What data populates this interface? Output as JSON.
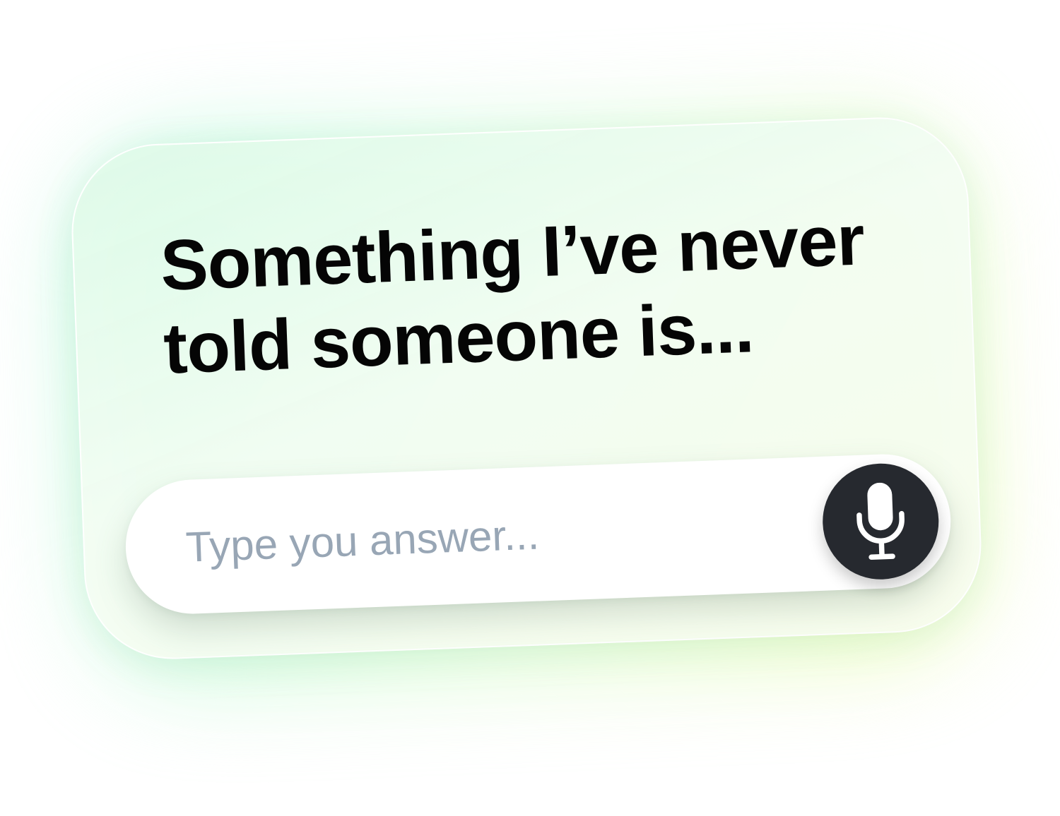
{
  "card": {
    "prompt": "Something I’ve never told someone is..."
  },
  "answer": {
    "placeholder": "Type you answer...",
    "value": ""
  },
  "mic_button": {
    "icon": "microphone-icon"
  },
  "colors": {
    "card_bg": "#eefcf0",
    "glow_green": "#9ff5d0",
    "glow_yellow": "#ecfcae",
    "prompt_text": "#050505",
    "placeholder_text": "#98a6b5",
    "mic_button_bg": "#26292f",
    "mic_icon": "#ffffff"
  }
}
